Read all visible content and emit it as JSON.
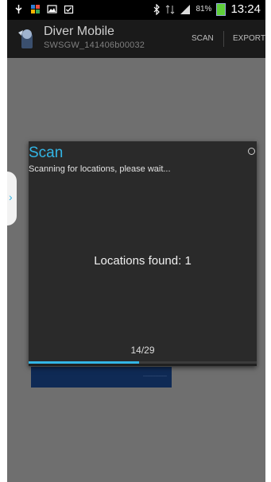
{
  "status_bar": {
    "battery": "81%",
    "time": "13:24"
  },
  "action_bar": {
    "title": "Diver Mobile",
    "subtitle": "SWSGW_141406b00032",
    "actions": [
      "SCAN",
      "EXPORT"
    ]
  },
  "dialog": {
    "title": "Scan",
    "message": "Scanning for locations, please wait...",
    "locations_found": "Locations found: 1",
    "progress_text": "14/29",
    "progress": 14,
    "total": 29
  },
  "colors": {
    "accent": "#33b5e5",
    "battery": "#5fcf3a"
  },
  "icons": [
    "usb-icon",
    "app-icon",
    "image-icon",
    "task-icon",
    "bluetooth-icon",
    "signal-icon",
    "battery-icon",
    "spinner-icon",
    "chevron-right-icon"
  ]
}
